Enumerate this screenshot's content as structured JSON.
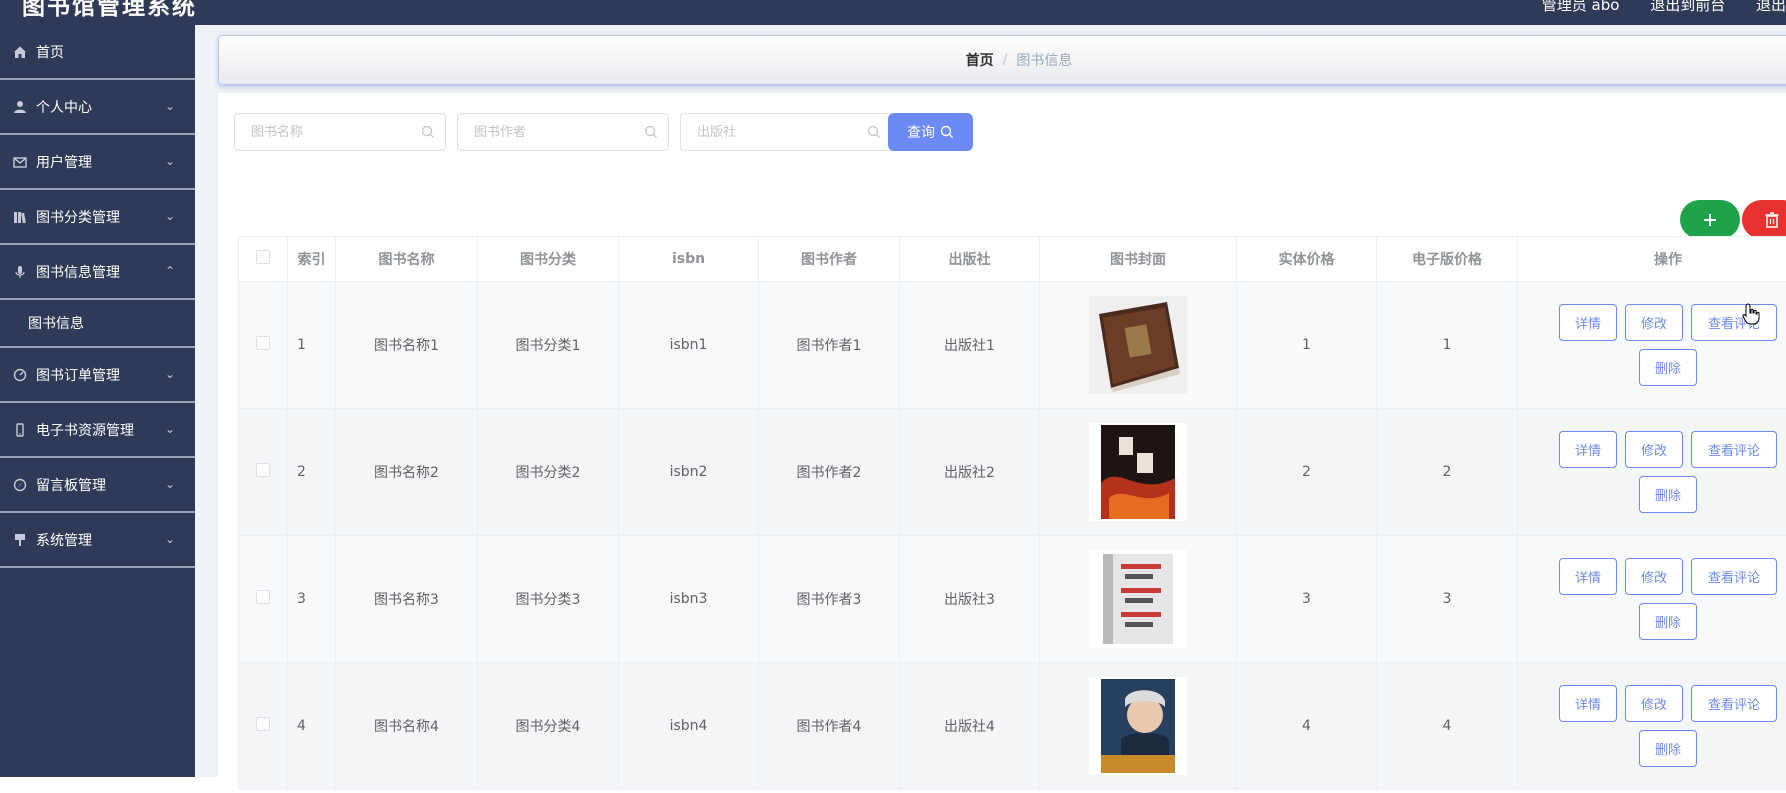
{
  "app": {
    "title": "图书馆管理系统",
    "top_right": [
      "管理员 abo",
      "退出到前台",
      "退出"
    ]
  },
  "sidebar": {
    "items": [
      {
        "label": "首页",
        "icon": "home-icon",
        "has_children": false
      },
      {
        "label": "个人中心",
        "icon": "user-icon",
        "has_children": true
      },
      {
        "label": "用户管理",
        "icon": "mail-icon",
        "has_children": true
      },
      {
        "label": "图书分类管理",
        "icon": "books-icon",
        "has_children": true
      },
      {
        "label": "图书信息管理",
        "icon": "microphone-icon",
        "has_children": true,
        "expanded": true,
        "children": [
          "图书信息"
        ]
      },
      {
        "label": "图书订单管理",
        "icon": "dashboard-icon",
        "has_children": true
      },
      {
        "label": "电子书资源管理",
        "icon": "phone-icon",
        "has_children": true
      },
      {
        "label": "留言板管理",
        "icon": "compass-icon",
        "has_children": true
      },
      {
        "label": "系统管理",
        "icon": "pin-icon",
        "has_children": true
      }
    ]
  },
  "breadcrumb": {
    "home": "首页",
    "separator": "/",
    "current": "图书信息"
  },
  "search": {
    "book_name_placeholder": "图书名称",
    "author_placeholder": "图书作者",
    "publisher_placeholder": "出版社",
    "query_label": "查询"
  },
  "toolbar": {
    "add_icon": "plus-icon",
    "delete_icon": "trash-icon"
  },
  "table": {
    "headers": [
      "索引",
      "图书名称",
      "图书分类",
      "isbn",
      "图书作者",
      "出版社",
      "图书封面",
      "实体价格",
      "电子版价格",
      "操作"
    ],
    "rows": [
      {
        "index": "1",
        "name": "图书名称1",
        "category": "图书分类1",
        "isbn": "isbn1",
        "author": "图书作者1",
        "publisher": "出版社1",
        "cover": "old-leather-book-cover",
        "price": "1",
        "ebook_price": "1"
      },
      {
        "index": "2",
        "name": "图书名称2",
        "category": "图书分类2",
        "isbn": "isbn2",
        "author": "图书作者2",
        "publisher": "出版社2",
        "cover": "dark-red-fire-book-cover",
        "price": "2",
        "ebook_price": "2"
      },
      {
        "index": "3",
        "name": "图书名称3",
        "category": "图书分类3",
        "isbn": "isbn3",
        "author": "图书作者3",
        "publisher": "出版社3",
        "cover": "white-grey-book-cover",
        "price": "3",
        "ebook_price": "3"
      },
      {
        "index": "4",
        "name": "图书名称4",
        "category": "图书分类4",
        "isbn": "isbn4",
        "author": "图书作者4",
        "publisher": "出版社4",
        "cover": "portrait-book-cover",
        "price": "4",
        "ebook_price": "4"
      }
    ],
    "actions": {
      "detail": "详情",
      "edit": "修改",
      "comments": "查看评论",
      "delete": "删除"
    }
  },
  "colors": {
    "sidebar_bg": "#2f3a58",
    "primary": "#6b8af5",
    "add_green": "#1fa24a",
    "delete_red": "#e8322f"
  }
}
